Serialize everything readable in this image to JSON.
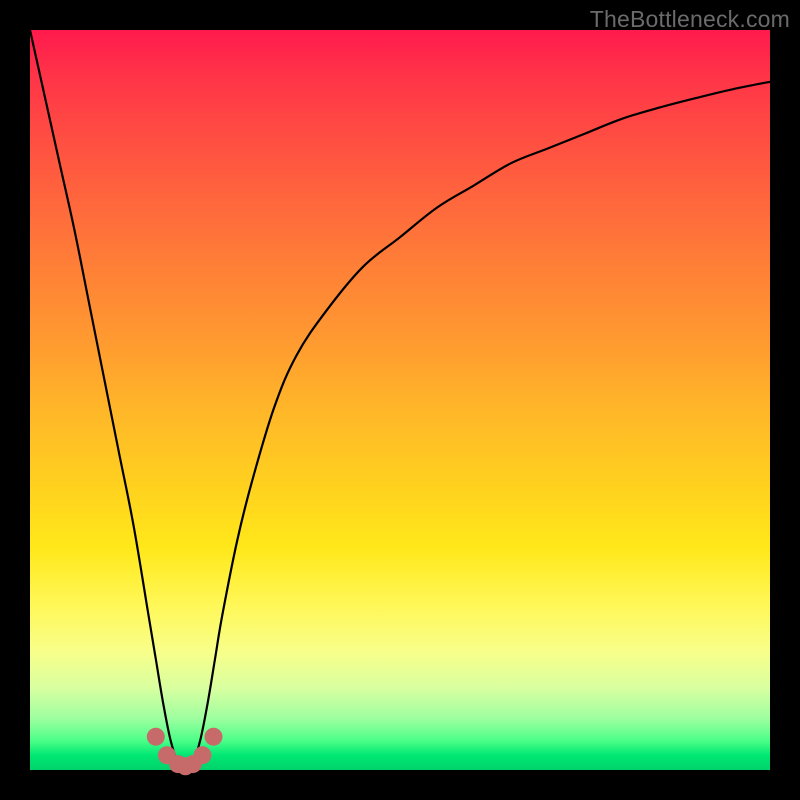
{
  "watermark": {
    "text": "TheBottleneck.com"
  },
  "chart_data": {
    "type": "line",
    "title": "",
    "xlabel": "",
    "ylabel": "",
    "xlim": [
      0,
      100
    ],
    "ylim": [
      0,
      100
    ],
    "grid": false,
    "legend": null,
    "series": [
      {
        "name": "curve",
        "x": [
          0,
          2,
          4,
          6,
          8,
          10,
          12,
          14,
          16,
          17,
          18,
          19,
          20,
          21,
          22,
          23,
          24,
          25,
          26,
          28,
          30,
          33,
          36,
          40,
          45,
          50,
          55,
          60,
          65,
          70,
          75,
          80,
          85,
          90,
          95,
          100
        ],
        "values": [
          100,
          91,
          82,
          73,
          63,
          53,
          43,
          33,
          21,
          15,
          9,
          4,
          1,
          0,
          1,
          4,
          9,
          15,
          21,
          31,
          39,
          49,
          56,
          62,
          68,
          72,
          76,
          79,
          82,
          84,
          86,
          88,
          89.5,
          90.8,
          92,
          93
        ]
      }
    ],
    "markers": {
      "name": "trough-dots",
      "color": "#c76a6a",
      "points": [
        {
          "x": 17.0,
          "y": 4.5
        },
        {
          "x": 18.5,
          "y": 2.0
        },
        {
          "x": 20.0,
          "y": 0.8
        },
        {
          "x": 21.0,
          "y": 0.5
        },
        {
          "x": 22.0,
          "y": 0.8
        },
        {
          "x": 23.3,
          "y": 2.0
        },
        {
          "x": 24.8,
          "y": 4.5
        }
      ]
    }
  }
}
